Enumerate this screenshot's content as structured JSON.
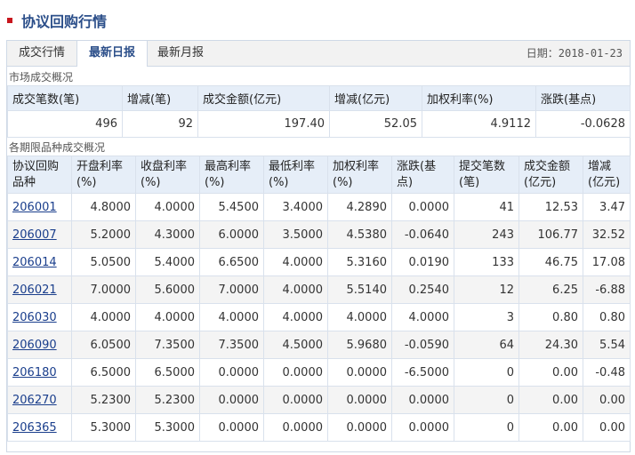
{
  "title": "协议回购行情",
  "tabs": [
    {
      "label": "成交行情"
    },
    {
      "label": "最新日报"
    },
    {
      "label": "最新月报"
    }
  ],
  "date_label": "日期：2018-01-23",
  "summary": {
    "section_title": "市场成交概况",
    "headers": [
      "成交笔数(笔)",
      "增减(笔)",
      "成交金额(亿元)",
      "增减(亿元)",
      "加权利率(%)",
      "涨跌(基点)"
    ],
    "values": [
      "496",
      "92",
      "197.40",
      "52.05",
      "4.9112",
      "-0.0628"
    ]
  },
  "detail": {
    "section_title": "各期限品种成交概况",
    "headers": [
      "协议回购品种",
      "开盘利率(%)",
      "收盘利率(%)",
      "最高利率(%)",
      "最低利率(%)",
      "加权利率(%)",
      "涨跌(基点)",
      "提交笔数(笔)",
      "成交金额(亿元)",
      "增减(亿元)"
    ],
    "rows": [
      [
        "206001",
        "4.8000",
        "4.0000",
        "5.4500",
        "3.4000",
        "4.2890",
        "0.0000",
        "41",
        "12.53",
        "3.47"
      ],
      [
        "206007",
        "5.2000",
        "4.3000",
        "6.0000",
        "3.5000",
        "4.5380",
        "-0.0640",
        "243",
        "106.77",
        "32.52"
      ],
      [
        "206014",
        "5.0500",
        "5.4000",
        "6.6500",
        "4.0000",
        "5.3160",
        "0.0190",
        "133",
        "46.75",
        "17.08"
      ],
      [
        "206021",
        "7.0000",
        "5.6000",
        "7.0000",
        "4.0000",
        "5.5140",
        "0.2540",
        "12",
        "6.25",
        "-6.88"
      ],
      [
        "206030",
        "4.0000",
        "4.0000",
        "4.0000",
        "4.0000",
        "4.0000",
        "4.0000",
        "3",
        "0.80",
        "0.80"
      ],
      [
        "206090",
        "6.0500",
        "7.3500",
        "7.3500",
        "4.5000",
        "5.9680",
        "-0.0590",
        "64",
        "24.30",
        "5.54"
      ],
      [
        "206180",
        "6.5000",
        "6.5000",
        "0.0000",
        "0.0000",
        "0.0000",
        "-6.5000",
        "0",
        "0.00",
        "-0.48"
      ],
      [
        "206270",
        "5.2300",
        "5.2300",
        "0.0000",
        "0.0000",
        "0.0000",
        "0.0000",
        "0",
        "0.00",
        "0.00"
      ],
      [
        "206365",
        "5.3000",
        "5.3000",
        "0.0000",
        "0.0000",
        "0.0000",
        "0.0000",
        "0",
        "0.00",
        "0.00"
      ]
    ]
  },
  "colors": {
    "accent": "#c8161d",
    "title": "#2c4f8a",
    "header_bg": "#e6eef8",
    "link": "#1a3e8c"
  }
}
